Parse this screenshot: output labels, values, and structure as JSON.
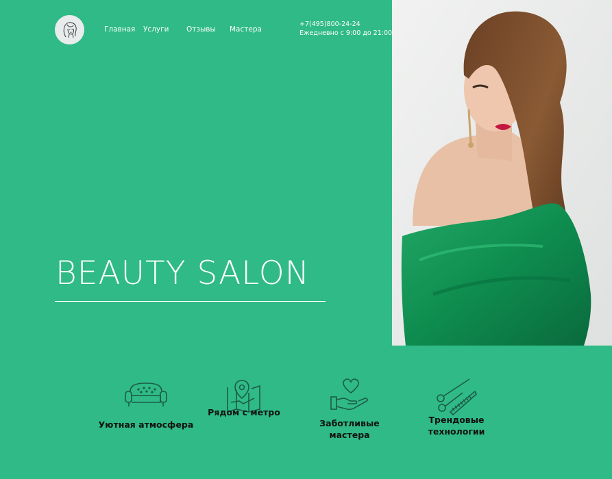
{
  "header": {
    "nav": [
      {
        "label": "Главная"
      },
      {
        "label": "Услуги"
      },
      {
        "label": "Отзывы"
      },
      {
        "label": "Мастера"
      }
    ],
    "phone": "+7(495)800-24-24",
    "hours": "Ежедневно с 9:00 до 21:00"
  },
  "hero": {
    "title": "BEAUTY SALON"
  },
  "features": [
    {
      "icon": "sofa-icon",
      "label": "Уютная атмосфера"
    },
    {
      "icon": "map-pin-icon",
      "label": "Рядом с метро"
    },
    {
      "icon": "heart-hand-icon",
      "label": "Заботливые мастера"
    },
    {
      "icon": "scissors-comb-icon",
      "label": "Трендовые технологии"
    }
  ],
  "colors": {
    "background": "#2fba87",
    "text": "#ffffff",
    "feature_text": "#111111",
    "icon_stroke": "#1d5b49"
  }
}
